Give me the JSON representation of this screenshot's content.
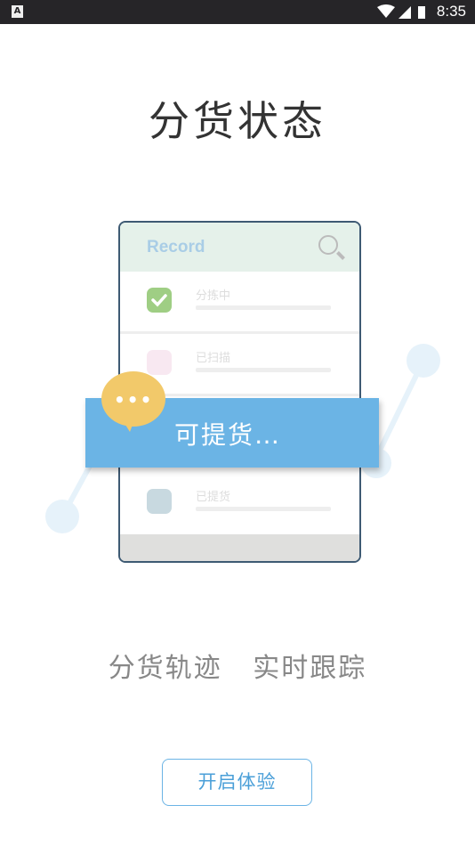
{
  "status_bar": {
    "time": "8:35",
    "notification_icon": "A"
  },
  "title": "分货状态",
  "illustration": {
    "card_header": "Record",
    "rows": [
      {
        "label": "分拣中",
        "color": "#9fce84",
        "checked": true
      },
      {
        "label": "已扫描",
        "color": "#f8e8f1",
        "checked": false
      },
      {
        "label": "",
        "color": "#ffffff",
        "checked": false
      },
      {
        "label": "已提货",
        "color": "#c8d9e0",
        "checked": false
      }
    ],
    "banner_text": "可提货…",
    "bubble_text": "•••"
  },
  "tagline": "分货轨迹   实时跟踪",
  "start_button": "开启体验",
  "colors": {
    "accent": "#6bb4e5",
    "bubble": "#f2c96a",
    "status_bar": "#262528"
  }
}
